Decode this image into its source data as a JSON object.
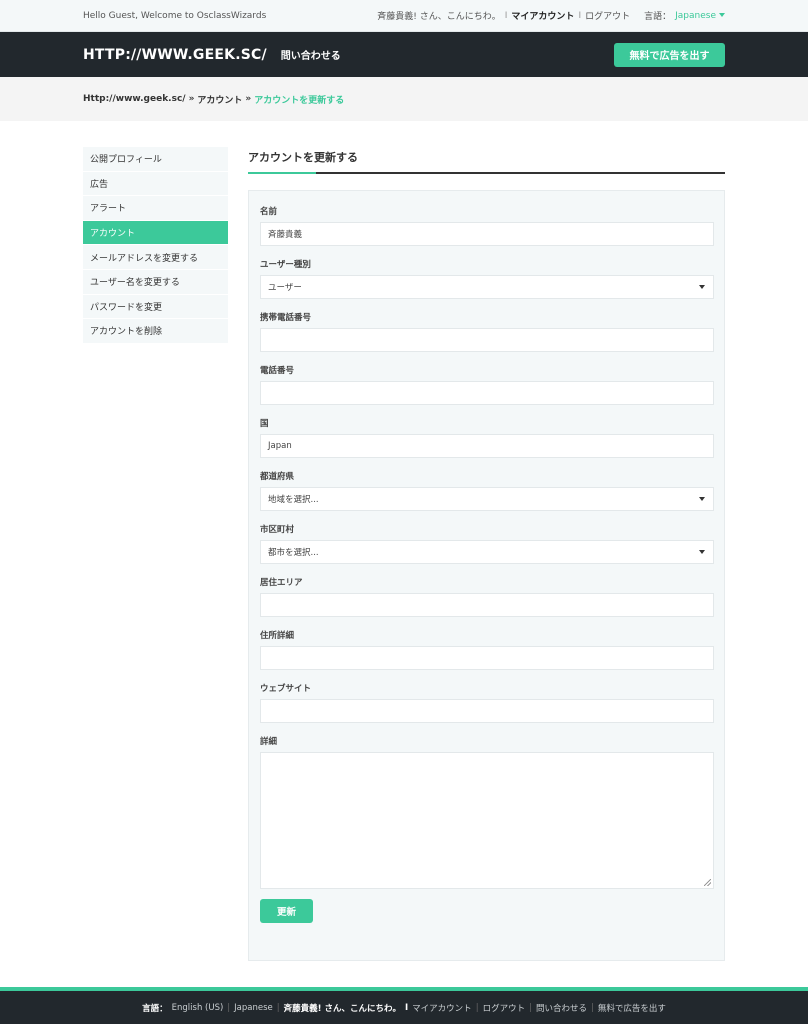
{
  "topbar": {
    "welcome": "Hello Guest, Welcome to OsclassWizards",
    "greeting": "斉藤貴義! さん、こんにちわ。",
    "sep": "I",
    "my_account": "マイアカウント",
    "logout": "ログアウト",
    "lang_label": "言語：",
    "lang_value": "Japanese"
  },
  "header": {
    "logo": "HTTP://WWW.GEEK.SC/",
    "contact": "問い合わせる",
    "post_button": "無料で広告を出す"
  },
  "breadcrumb": {
    "home": "Http://www.geek.sc/",
    "sep": "»",
    "account": "アカウント",
    "current": "アカウントを更新する"
  },
  "sidebar": {
    "items": [
      {
        "label": "公開プロフィール"
      },
      {
        "label": "広告"
      },
      {
        "label": "アラート"
      },
      {
        "label": "アカウント"
      },
      {
        "label": "メールアドレスを変更する"
      },
      {
        "label": "ユーザー名を変更する"
      },
      {
        "label": "パスワードを変更"
      },
      {
        "label": "アカウントを削除"
      }
    ]
  },
  "form": {
    "title": "アカウントを更新する",
    "name_label": "名前",
    "name_value": "斉藤貴義",
    "user_type_label": "ユーザー種別",
    "user_type_value": "ユーザー",
    "mobile_label": "携帯電話番号",
    "mobile_value": "",
    "phone_label": "電話番号",
    "phone_value": "",
    "country_label": "国",
    "country_value": "Japan",
    "region_label": "都道府県",
    "region_value": "地域を選択...",
    "city_label": "市区町村",
    "city_value": "都市を選択...",
    "area_label": "居住エリア",
    "area_value": "",
    "address_label": "住所詳細",
    "address_value": "",
    "website_label": "ウェブサイト",
    "website_value": "",
    "details_label": "詳細",
    "submit_label": "更新"
  },
  "footer": {
    "lang_label": "言語：",
    "english": "English (US)",
    "japanese": "Japanese",
    "greeting": "斉藤貴義! さん、こんにちわ。",
    "sep_bold": "I",
    "my_account": "マイアカウント",
    "logout": "ログアウト",
    "contact": "問い合わせる",
    "post": "無料で広告を出す",
    "sep": "|"
  },
  "colors": {
    "accent": "#3cc99a",
    "dark": "#22282d"
  }
}
